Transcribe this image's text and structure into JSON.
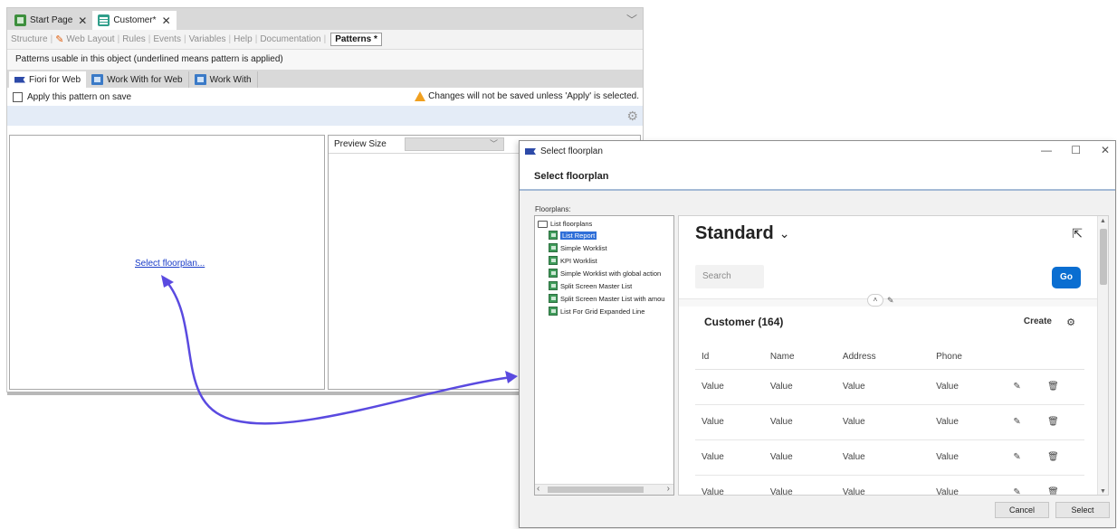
{
  "colors": {
    "accent": "#0a6ed1",
    "arrow": "#5a4ae0",
    "selection": "#2f6fd8",
    "link": "#1a3cc8",
    "warning": "#f0a020"
  },
  "ide": {
    "doc_tabs": [
      {
        "label": "Start Page",
        "icon": "start-page-icon"
      },
      {
        "label": "Customer*",
        "icon": "transaction-icon"
      }
    ],
    "section_tabs": [
      "Structure",
      "Web Layout",
      "Rules",
      "Events",
      "Variables",
      "Help",
      "Documentation"
    ],
    "section_active": "Patterns *",
    "info_text": "Patterns usable in this object (underlined means pattern is applied)",
    "pattern_tabs": [
      "Fiori for Web",
      "Work With for Web",
      "Work With"
    ],
    "apply_label": "Apply this pattern on save",
    "warning_text": "Changes will not be saved unless 'Apply' is selected.",
    "select_link": "Select floorplan...",
    "preview_size_label": "Preview Size"
  },
  "dialog": {
    "window_title": "Select floorplan",
    "header": "Select floorplan",
    "floorplans_label": "Floorplans:",
    "tree_root": "List floorplans",
    "tree_items": [
      "List Report",
      "Simple Worklist",
      "KPI Worklist",
      "Simple Worklist with global action",
      "Split Screen Master List",
      "Split Screen Master List with amou",
      "List For Grid Expanded Line"
    ],
    "preview": {
      "title": "Standard",
      "search_placeholder": "Search",
      "go": "Go",
      "table_title": "Customer (164)",
      "create": "Create",
      "columns": [
        "Id",
        "Name",
        "Address",
        "Phone"
      ],
      "rows": [
        [
          "Value",
          "Value",
          "Value",
          "Value"
        ],
        [
          "Value",
          "Value",
          "Value",
          "Value"
        ],
        [
          "Value",
          "Value",
          "Value",
          "Value"
        ],
        [
          "Value",
          "Value",
          "Value",
          "Value"
        ]
      ]
    },
    "buttons": {
      "cancel": "Cancel",
      "select": "Select"
    }
  }
}
